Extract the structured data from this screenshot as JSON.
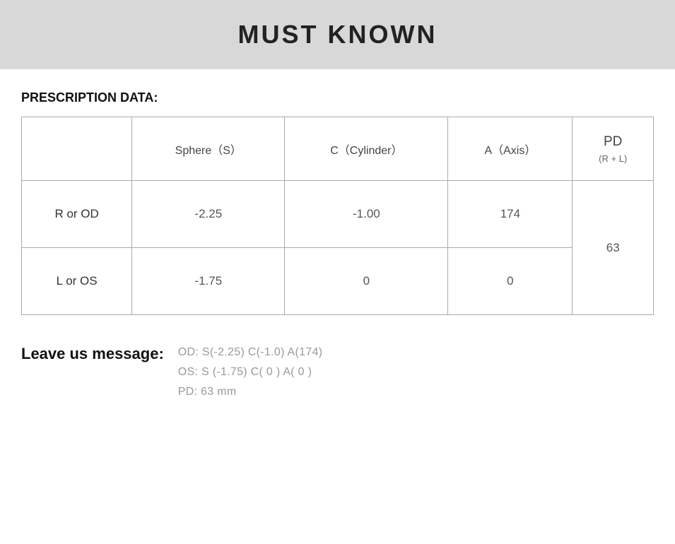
{
  "header": {
    "title": "MUST KNOWN"
  },
  "prescription": {
    "section_label": "PRESCRIPTION DATA:",
    "table": {
      "columns": [
        {
          "id": "label",
          "header": ""
        },
        {
          "id": "sphere",
          "header": "Sphere（S）"
        },
        {
          "id": "cylinder",
          "header": "C（Cylinder）"
        },
        {
          "id": "axis",
          "header": "A（Axis）"
        },
        {
          "id": "pd",
          "header_main": "PD",
          "header_sub": "(R + L)"
        }
      ],
      "rows": [
        {
          "label": "R or OD",
          "sphere": "-2.25",
          "cylinder": "-1.00",
          "axis": "174",
          "pd": ""
        },
        {
          "label": "L or OS",
          "sphere": "-1.75",
          "cylinder": "0",
          "axis": "0",
          "pd": "63"
        }
      ]
    }
  },
  "leave_message": {
    "label": "Leave us message:",
    "lines": [
      "OD:  S(-2.25)    C(-1.0)    A(174)",
      "OS:  S (-1.75)    C( 0 )     A( 0 )",
      "PD:  63 mm"
    ]
  }
}
